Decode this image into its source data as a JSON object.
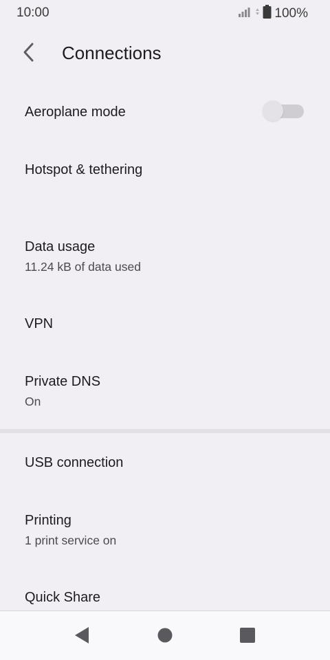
{
  "status_bar": {
    "time": "10:00",
    "battery": "100%",
    "icons": [
      "signal-icon",
      "data-arrows-icon",
      "battery-icon"
    ]
  },
  "app_bar": {
    "title": "Connections",
    "back_icon": "back-arrow-icon"
  },
  "settings": {
    "aeroplane_mode": {
      "title": "Aeroplane mode",
      "enabled": false
    },
    "hotspot": {
      "title": "Hotspot & tethering"
    },
    "data_usage": {
      "title": "Data usage",
      "summary": "11.24 kB of data used"
    },
    "vpn": {
      "title": "VPN"
    },
    "private_dns": {
      "title": "Private DNS",
      "summary": "On"
    },
    "usb_connection": {
      "title": "USB connection"
    },
    "printing": {
      "title": "Printing",
      "summary": "1 print service on"
    },
    "quick_share": {
      "title": "Quick Share"
    }
  },
  "nav_bar": {
    "icons": [
      "nav-back-icon",
      "nav-home-icon",
      "nav-recents-icon"
    ]
  },
  "colors": {
    "background": "#f1eff3",
    "text_primary": "#1c1b1f",
    "text_secondary": "#4a4a4f",
    "toggle_track": "#cfcdd1",
    "toggle_thumb": "#e4e2e6",
    "nav_icon": "#5a5a5e"
  }
}
